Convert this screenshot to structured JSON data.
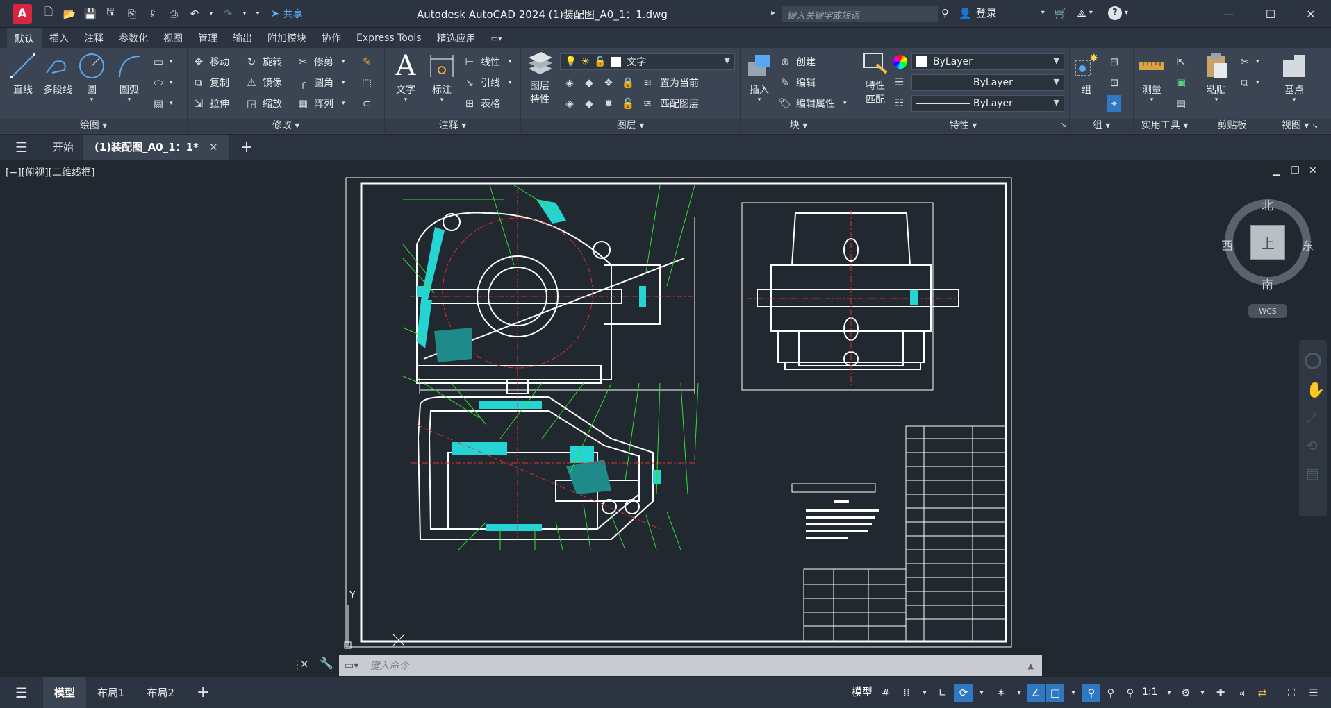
{
  "app": {
    "logo_letter": "A",
    "title": "Autodesk AutoCAD 2024    (1)装配图_A0_1：1.dwg",
    "search_placeholder": "键入关键字或短语",
    "login": "登录",
    "share": "共享",
    "accent": "#d9263f",
    "link_color": "#5fb4ff"
  },
  "ribbon_tabs": [
    "默认",
    "插入",
    "注释",
    "参数化",
    "视图",
    "管理",
    "输出",
    "附加模块",
    "协作",
    "Express Tools",
    "精选应用"
  ],
  "ribbon": {
    "draw": {
      "title": "绘图",
      "line": "直线",
      "polyline": "多段线",
      "circle": "圆",
      "arc": "圆弧"
    },
    "modify": {
      "title": "修改",
      "move": "移动",
      "rotate": "旋转",
      "trim": "修剪",
      "copy": "复制",
      "mirror": "镜像",
      "fillet": "圆角",
      "stretch": "拉伸",
      "scale": "缩放",
      "array": "阵列"
    },
    "annotation": {
      "title": "注释",
      "text": "文字",
      "dimension": "标注",
      "linear": "线性",
      "leader": "引线",
      "table": "表格"
    },
    "layers": {
      "title": "图层",
      "layer_properties_1": "图层",
      "layer_properties_2": "特性",
      "current_layer": "文字",
      "set_current": "置为当前",
      "match_layer": "匹配图层"
    },
    "block": {
      "title": "块",
      "insert": "插入",
      "create": "创建",
      "edit": "编辑",
      "edit_attributes": "编辑属性"
    },
    "properties": {
      "title": "特性",
      "match_1": "特性",
      "match_2": "匹配",
      "color": "ByLayer",
      "linetype": "ByLayer",
      "lineweight": "ByLayer"
    },
    "group": {
      "title": "组",
      "group": "组"
    },
    "utilities": {
      "title": "实用工具",
      "measure": "测量"
    },
    "clipboard": {
      "title": "剪贴板",
      "paste": "粘贴"
    },
    "view": {
      "title": "视图",
      "base": "基点"
    }
  },
  "doc_tabs": {
    "start": "开始",
    "active": "(1)装配图_A0_1：1*"
  },
  "viewport": {
    "label": "[−][俯视][二维线框]",
    "compass": {
      "north": "北",
      "south": "南",
      "east": "东",
      "west": "西",
      "top": "上"
    },
    "wcs": "WCS",
    "ucs_y": "Y"
  },
  "command_line": {
    "placeholder": "键入命令"
  },
  "status_tabs": [
    "模型",
    "布局1",
    "布局2"
  ],
  "status": {
    "model": "模型",
    "scale": "1:1"
  }
}
